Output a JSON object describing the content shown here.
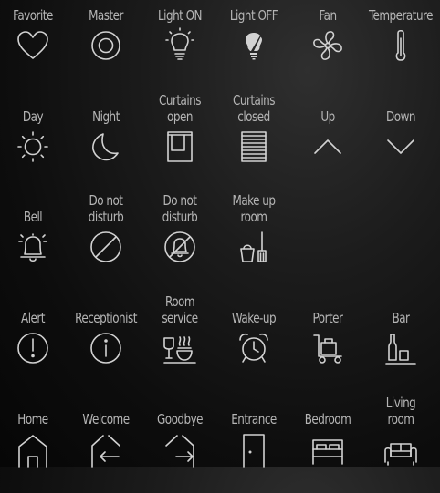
{
  "theme": {
    "background": "#0a0a0a",
    "icon_color": "#d2d2d2",
    "text_color": "#b5b5b5"
  },
  "rows": [
    {
      "items": [
        {
          "label": "Favorite",
          "icon": "heart-icon"
        },
        {
          "label": "Master",
          "icon": "master-ring-icon"
        },
        {
          "label": "Light ON",
          "icon": "bulb-on-icon"
        },
        {
          "label": "Light OFF",
          "icon": "bulb-off-icon"
        },
        {
          "label": "Fan",
          "icon": "fan-icon"
        },
        {
          "label": "Temperature",
          "icon": "thermometer-icon"
        }
      ]
    },
    {
      "items": [
        {
          "label": "Day",
          "icon": "sun-icon"
        },
        {
          "label": "Night",
          "icon": "moon-icon"
        },
        {
          "label": "Curtains\nopen",
          "icon": "curtains-open-icon"
        },
        {
          "label": "Curtains\nclosed",
          "icon": "curtains-closed-icon"
        },
        {
          "label": "Up",
          "icon": "chevron-up-icon"
        },
        {
          "label": "Down",
          "icon": "chevron-down-icon"
        }
      ]
    },
    {
      "items": [
        {
          "label": "Bell",
          "icon": "bell-icon"
        },
        {
          "label": "Do not\ndisturb",
          "icon": "do-not-disturb-icon"
        },
        {
          "label": "Do not\ndisturb",
          "icon": "bell-off-icon"
        },
        {
          "label": "Make up\nroom",
          "icon": "make-up-room-icon"
        }
      ]
    },
    {
      "items": [
        {
          "label": "Alert",
          "icon": "alert-icon"
        },
        {
          "label": "Receptionist",
          "icon": "info-icon"
        },
        {
          "label": "Room\nservice",
          "icon": "room-service-icon"
        },
        {
          "label": "Wake-up",
          "icon": "alarm-clock-icon"
        },
        {
          "label": "Porter",
          "icon": "luggage-cart-icon"
        },
        {
          "label": "Bar",
          "icon": "bar-bottle-icon"
        }
      ]
    },
    {
      "items": [
        {
          "label": "Home",
          "icon": "home-icon"
        },
        {
          "label": "Welcome",
          "icon": "welcome-icon"
        },
        {
          "label": "Goodbye",
          "icon": "goodbye-icon"
        },
        {
          "label": "Entrance",
          "icon": "door-icon"
        },
        {
          "label": "Bedroom",
          "icon": "bed-icon"
        },
        {
          "label": "Living\nroom",
          "icon": "sofa-icon"
        }
      ]
    }
  ]
}
